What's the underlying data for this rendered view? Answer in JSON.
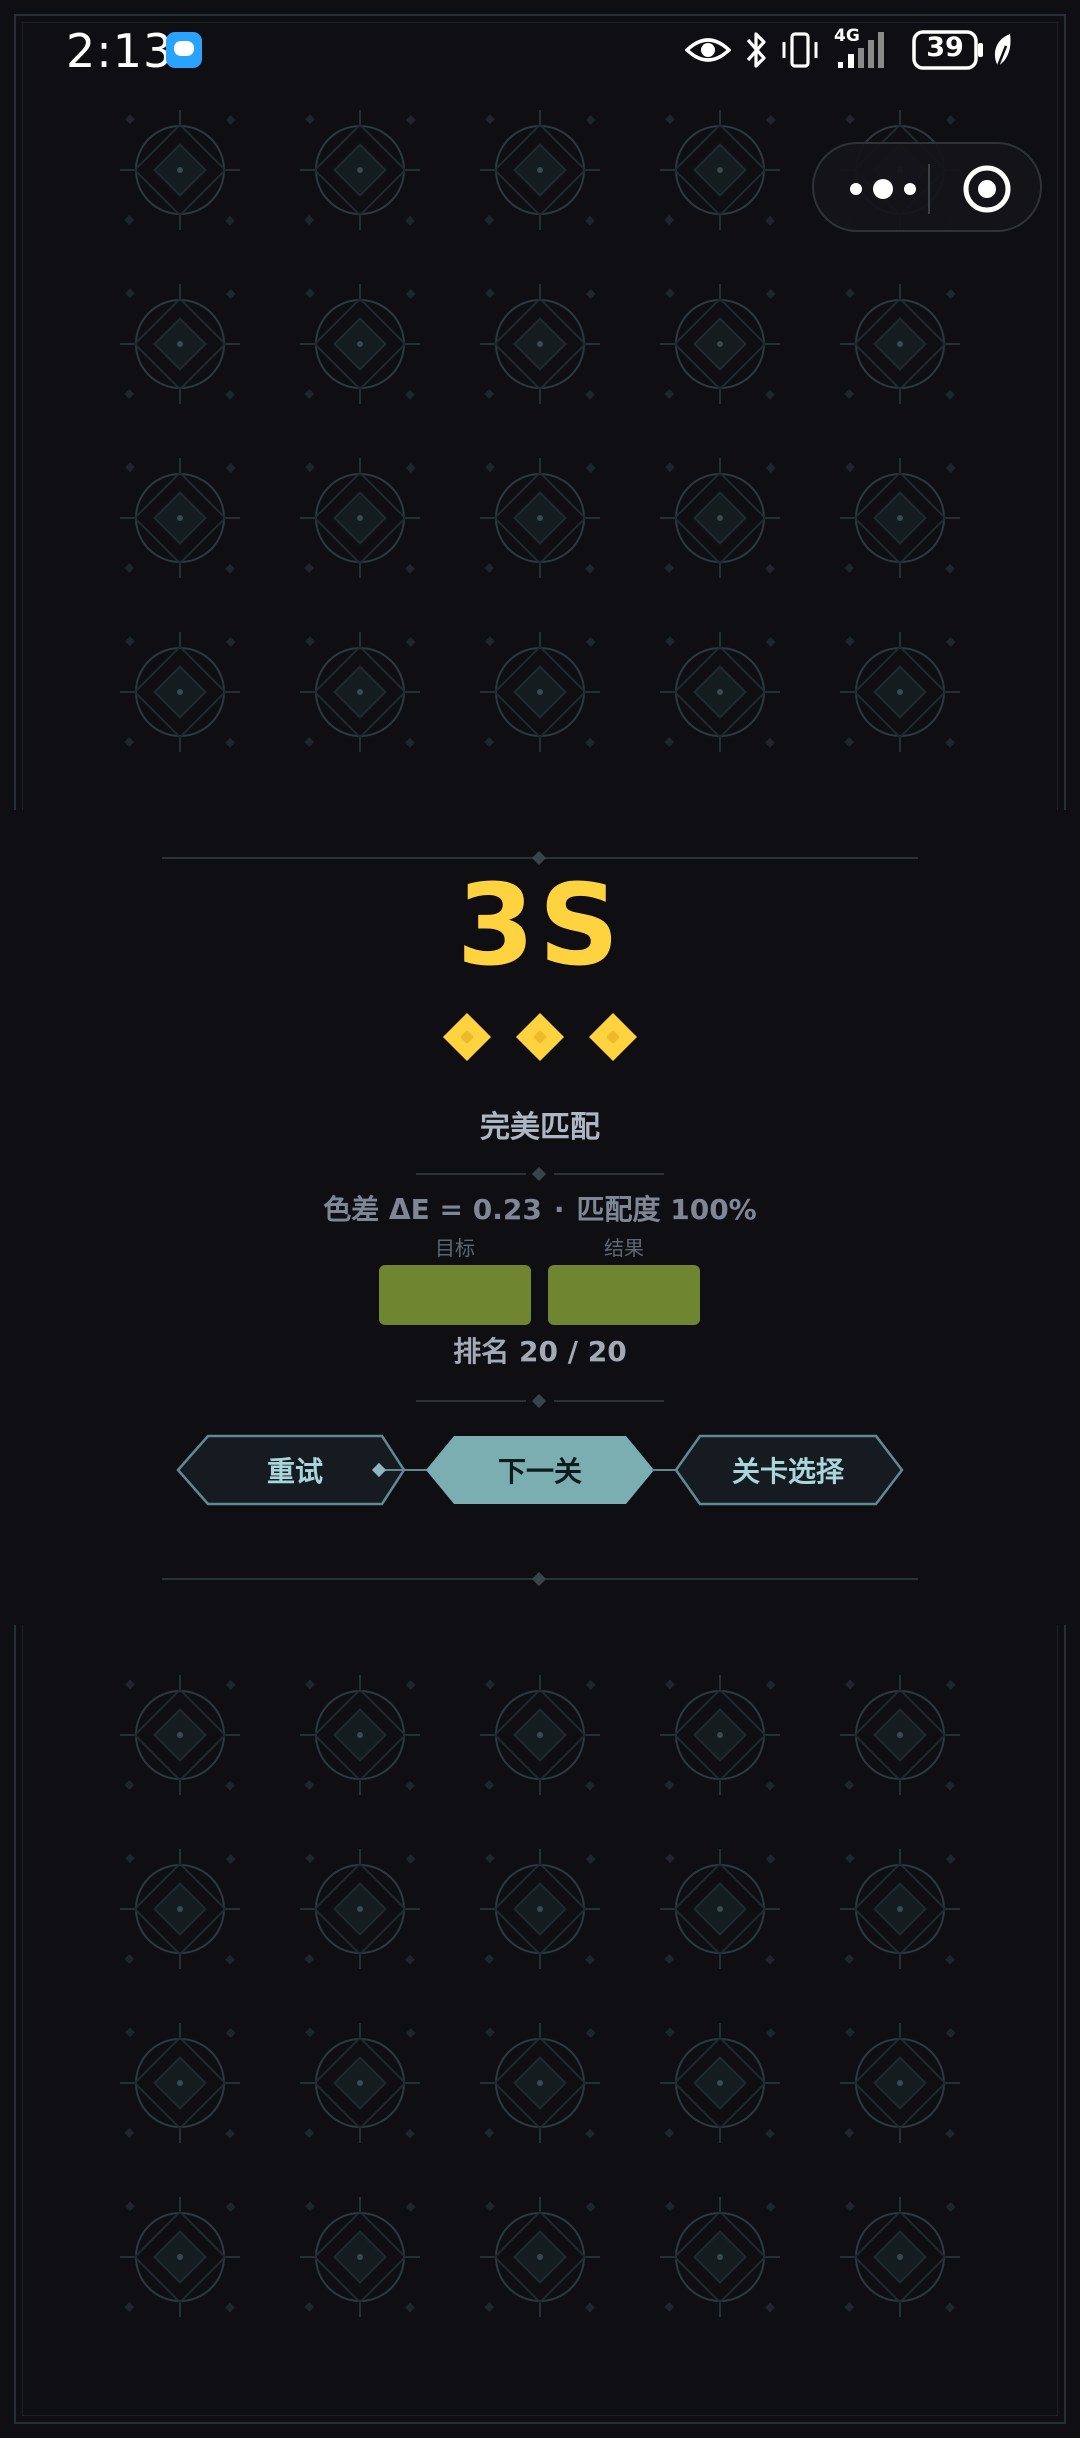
{
  "status_bar": {
    "time": "2:13",
    "network": "4G",
    "battery": "39"
  },
  "result": {
    "grade": "3S",
    "stars_count": 3,
    "verdict": "完美匹配",
    "delta_e": "色差 ΔE = 0.23",
    "separator": "·",
    "match": "匹配度 100%",
    "target_label": "目标",
    "result_label": "结果",
    "target_color": "#6f8530",
    "result_color": "#6f8530",
    "rank": "排名 20 / 20"
  },
  "actions": {
    "retry": "重试",
    "next": "下一关",
    "level_select": "关卡选择"
  },
  "colors": {
    "background": "#0e0e13",
    "accent_gold": "#ffd23f",
    "primary_button": "#7aaeb0",
    "secondary_button": "#151b20",
    "button_border": "#5f8a92"
  }
}
